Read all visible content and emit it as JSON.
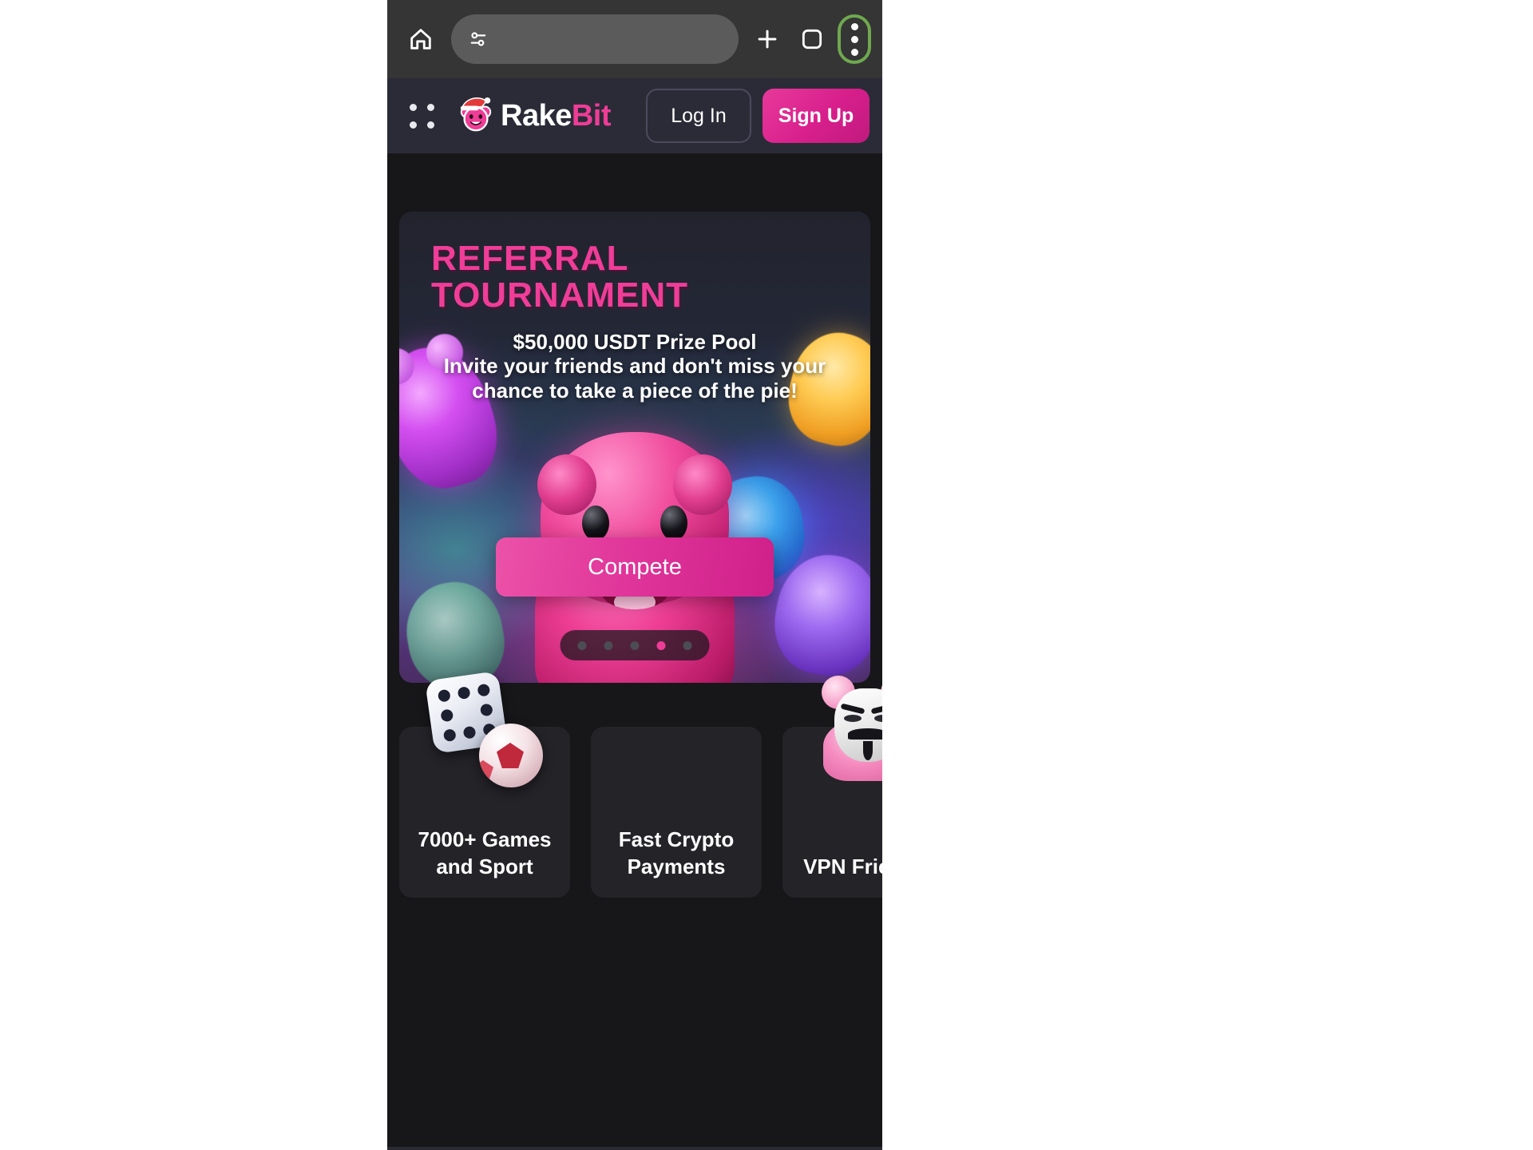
{
  "browser": {
    "home_icon": "home-icon",
    "url_value": "",
    "url_placeholder": "",
    "tune_icon": "tune-icon",
    "new_tab_icon": "plus-icon",
    "tab_switcher_icon": "square-icon",
    "menu_icon": "three-dot-menu-icon",
    "menu_highlight_color": "#6fa84f",
    "toolbar_bg": "#353535"
  },
  "header": {
    "grid_menu_icon": "grid-menu-icon",
    "logo_icon": "bear-santa-hat-logo",
    "brand_first": "Rake",
    "brand_second": "Bit",
    "brand_accent_color": "#ee3d96",
    "login_label": "Log In",
    "signup_label": "Sign Up",
    "bg": "#2b2b38"
  },
  "hero": {
    "title": "REFERRAL\nTOURNAMENT",
    "title_color": "#ef3d98",
    "subtitle": "$50,000 USDT Prize Pool\nInvite your friends and don't miss your\nchance to take a piece of the pie!",
    "cta_label": "Compete",
    "cta_color": "#e0359a",
    "bear_icon": "pink-gummy-bear",
    "gummy_left_icon": "purple-gummy-bear",
    "gummy_right_icon": "yellow-gummy-bear",
    "gummy_blue_icon": "blue-gummy-bear",
    "gummy_bottom_right_icon": "violet-gummy-bear",
    "gummy_bottom_left_icon": "green-gummy-bear",
    "carousel": {
      "total": 5,
      "active_index": 3,
      "active_color": "#ee3d96",
      "inactive_color": "#4c4c55"
    }
  },
  "features": [
    {
      "label": "7000+ Games\nand Sport",
      "icon": "dice-and-soccer-ball-icon"
    },
    {
      "label": "Fast Crypto\nPayments",
      "icon": "lightning-bolt-icon"
    },
    {
      "label": "VPN Friendly",
      "icon": "anonymous-mask-bear-icon"
    }
  ],
  "page": {
    "bg": "#17171a",
    "card_bg": "#232328"
  }
}
